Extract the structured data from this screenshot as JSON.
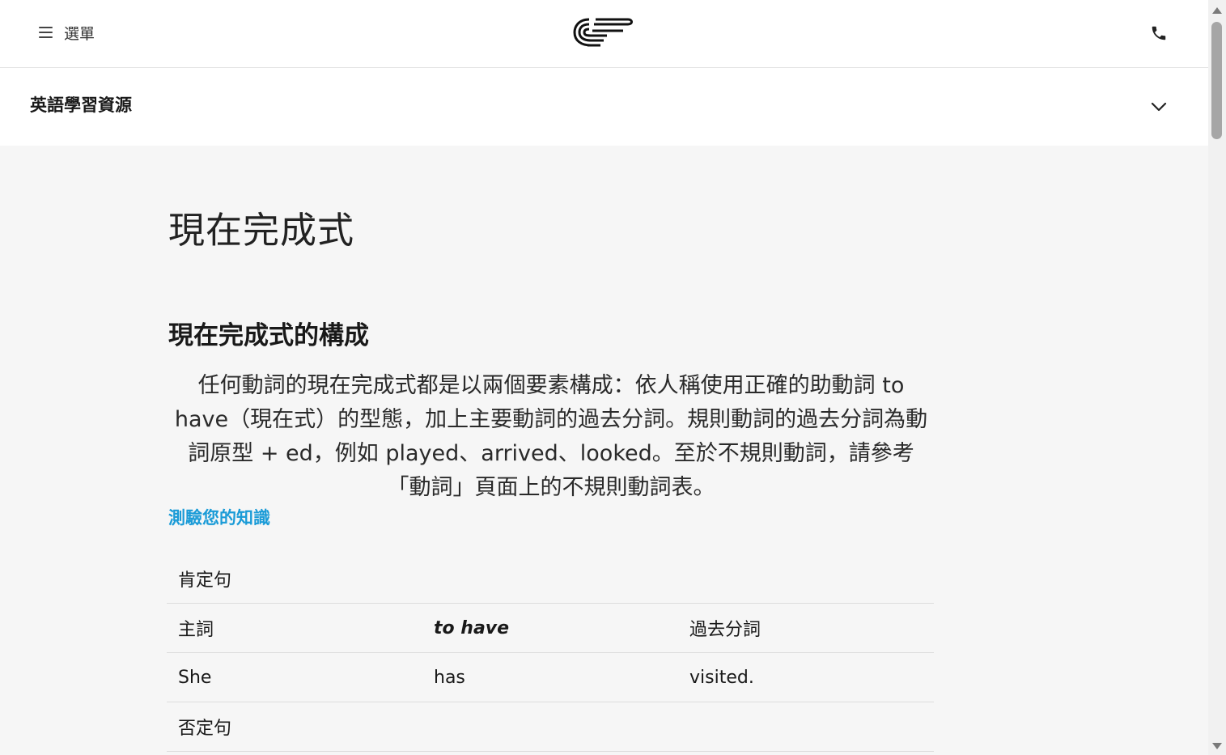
{
  "header": {
    "menu_label": "選單",
    "logo_icon": "ef-logo-icon",
    "phone_icon": "phone-icon"
  },
  "subnav": {
    "title": "英語學習資源",
    "toggle_icon": "chevron-down-icon"
  },
  "main": {
    "title": "現在完成式",
    "section_heading": "現在完成式的構成",
    "intro": "任何動詞的現在完成式都是以兩個要素構成：依人稱使用正確的助動詞 to have（現在式）的型態，加上主要動詞的過去分詞。規則動詞的過去分詞為動詞原型 + ed，例如 played、arrived、looked。至於不規則動詞，請參考「動詞」頁面上的不規則動詞表。",
    "quiz_link": "測驗您的知識"
  },
  "table": {
    "affirmative_label": "肯定句",
    "headers": [
      "主詞",
      "to have",
      "過去分詞"
    ],
    "row": [
      "She",
      "has",
      "visited."
    ],
    "negative_label": "否定句"
  },
  "colors": {
    "link": "#1a9bd7",
    "background": "#f6f6f6",
    "text": "#191919"
  }
}
